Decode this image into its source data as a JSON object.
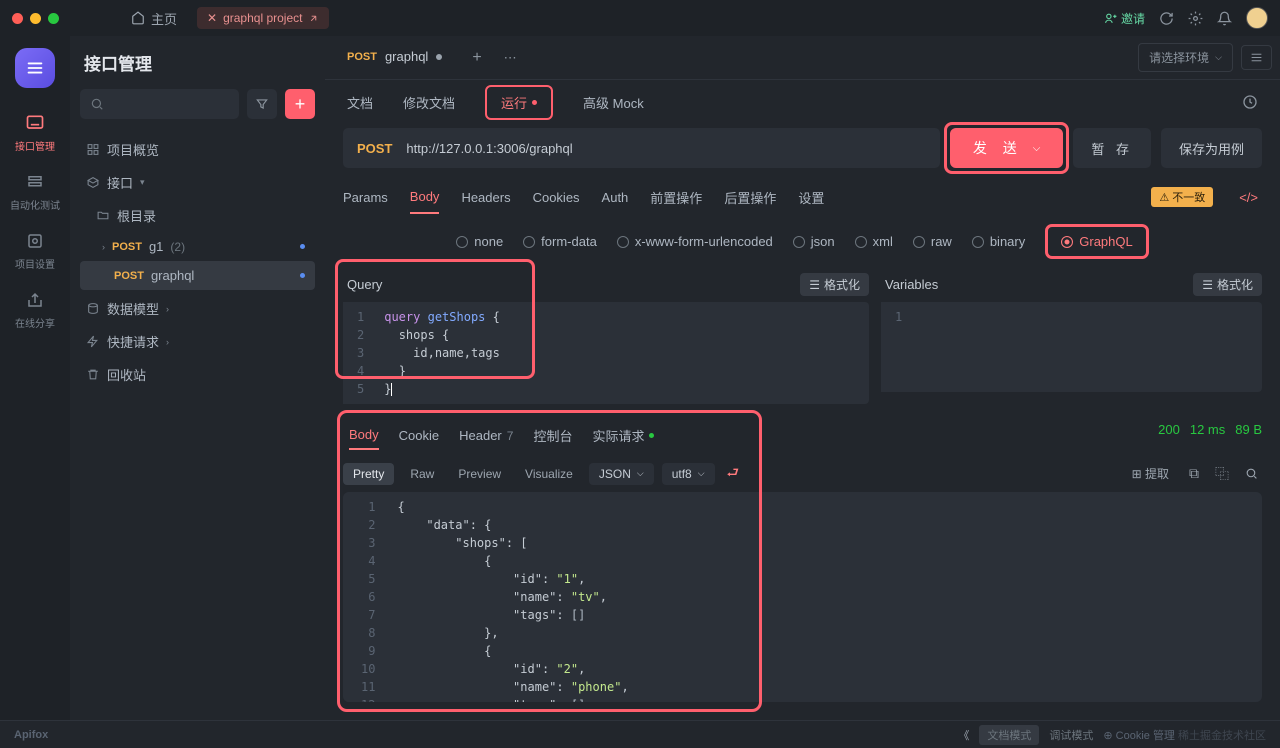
{
  "titlebar": {
    "home": "主页",
    "tab": "graphql project",
    "invite": "邀请"
  },
  "rail": {
    "items": [
      "接口管理",
      "自动化测试",
      "项目设置",
      "在线分享"
    ]
  },
  "sidebar": {
    "title": "接口管理",
    "tree": {
      "overview": "项目概览",
      "interface": "接口",
      "rootdir": "根目录",
      "g1": {
        "method": "POST",
        "name": "g1",
        "count": "(2)"
      },
      "graphql": {
        "method": "POST",
        "name": "graphql"
      },
      "datamodel": "数据模型",
      "quickreq": "快捷请求",
      "recycle": "回收站"
    }
  },
  "tabs": {
    "file_method": "POST",
    "file_name": "graphql",
    "env_placeholder": "请选择环境"
  },
  "subtabs": {
    "doc": "文档",
    "edit": "修改文档",
    "run": "运行",
    "mock": "高级 Mock"
  },
  "request": {
    "method": "POST",
    "url": "http://127.0.0.1:3006/graphql",
    "send": "发 送",
    "save": "暂 存",
    "savecase": "保存为用例"
  },
  "reqtabs": [
    "Params",
    "Body",
    "Headers",
    "Cookies",
    "Auth",
    "前置操作",
    "后置操作",
    "设置"
  ],
  "inconsistent": "不一致",
  "bodytypes": [
    "none",
    "form-data",
    "x-www-form-urlencoded",
    "json",
    "xml",
    "raw",
    "binary",
    "GraphQL"
  ],
  "editor": {
    "query_title": "Query",
    "vars_title": "Variables",
    "format": "格式化",
    "query_lines": [
      "query getShops {",
      "  shops {",
      "    id,name,tags",
      "  }",
      "}"
    ]
  },
  "response": {
    "tabs": {
      "body": "Body",
      "cookie": "Cookie",
      "header": "Header",
      "header_count": "7",
      "console": "控制台",
      "actual": "实际请求"
    },
    "views": {
      "pretty": "Pretty",
      "raw": "Raw",
      "preview": "Preview",
      "visualize": "Visualize",
      "json": "JSON",
      "utf8": "utf8"
    },
    "extract": "提取",
    "stats": {
      "code": "200",
      "time": "12 ms",
      "size": "89 B"
    },
    "json_lines": [
      "{",
      "    \"data\": {",
      "        \"shops\": [",
      "            {",
      "                \"id\": \"1\",",
      "                \"name\": \"tv\",",
      "                \"tags\": []",
      "            },",
      "            {",
      "                \"id\": \"2\",",
      "                \"name\": \"phone\",",
      "                \"tags\": []"
    ]
  },
  "footer": {
    "logo": "Apifox",
    "doc_mode": "文档模式",
    "debug_mode": "调试模式",
    "cookie": "Cookie 管理",
    "watermark": "稀土掘金技术社区"
  }
}
